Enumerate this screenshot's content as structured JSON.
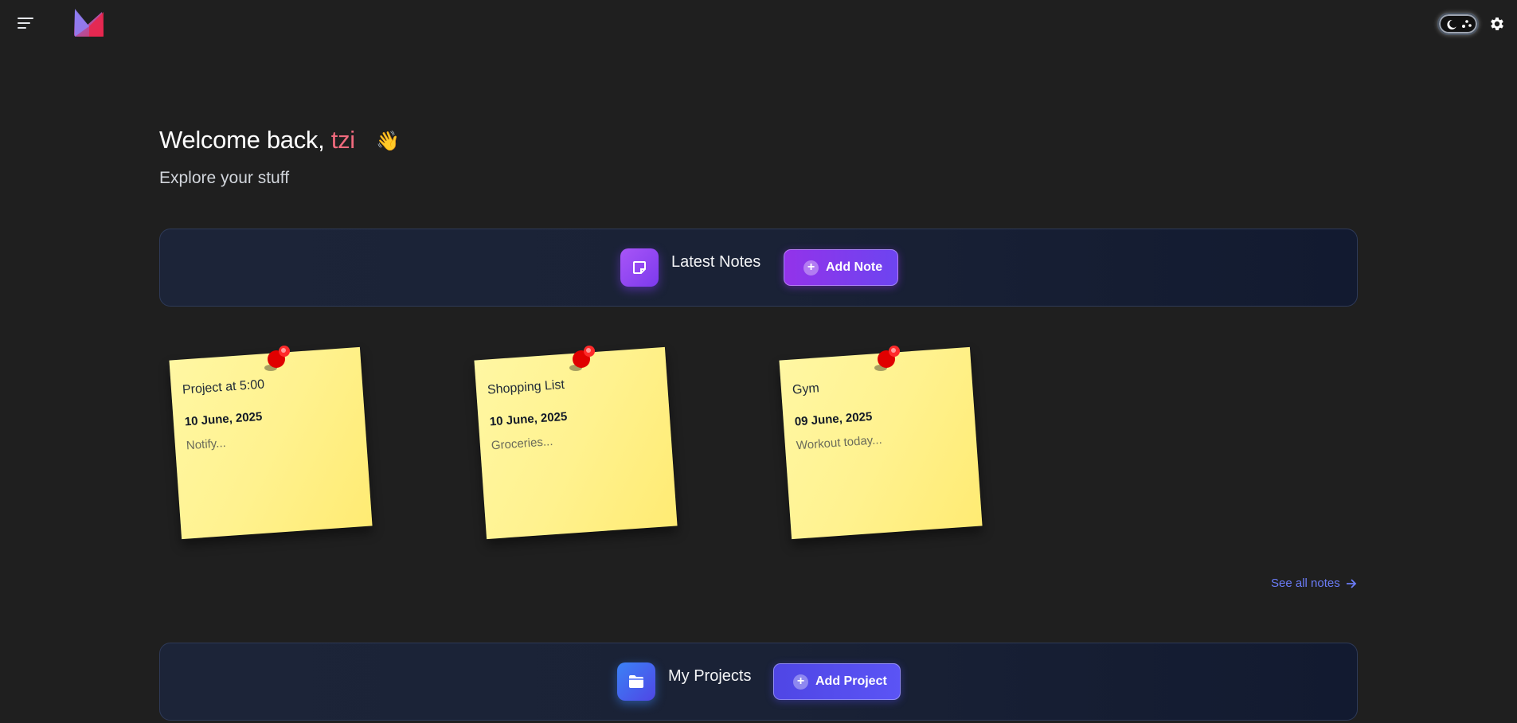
{
  "header": {
    "menu_icon": "hamburger-menu-icon",
    "logo_icon": "app-logo",
    "theme_toggle_icon": "moon-icon",
    "settings_icon": "gear-icon"
  },
  "welcome": {
    "greeting": "Welcome back,",
    "username": "tzi",
    "wave": "👋",
    "subtitle": "Explore your stuff"
  },
  "notes_section": {
    "title": "Latest Notes",
    "icon": "sticky-note-icon",
    "add_label": "Add Note",
    "see_all_label": "See all notes",
    "notes": [
      {
        "title": "Project at 5:00",
        "date": "10 June, 2025",
        "preview": "Notify..."
      },
      {
        "title": "Shopping List",
        "date": "10 June, 2025",
        "preview": "Groceries..."
      },
      {
        "title": "Gym",
        "date": "09 June, 2025",
        "preview": "Workout today..."
      }
    ]
  },
  "projects_section": {
    "title": "My Projects",
    "icon": "folder-icon",
    "add_label": "Add Project"
  },
  "colors": {
    "background": "#1f1f1f",
    "accent_pink": "#ef6a7d",
    "note_button": "#8b3cf0",
    "project_button": "#4f46e5",
    "sticky_note": "#fff28f",
    "link": "#6b7cf7"
  }
}
